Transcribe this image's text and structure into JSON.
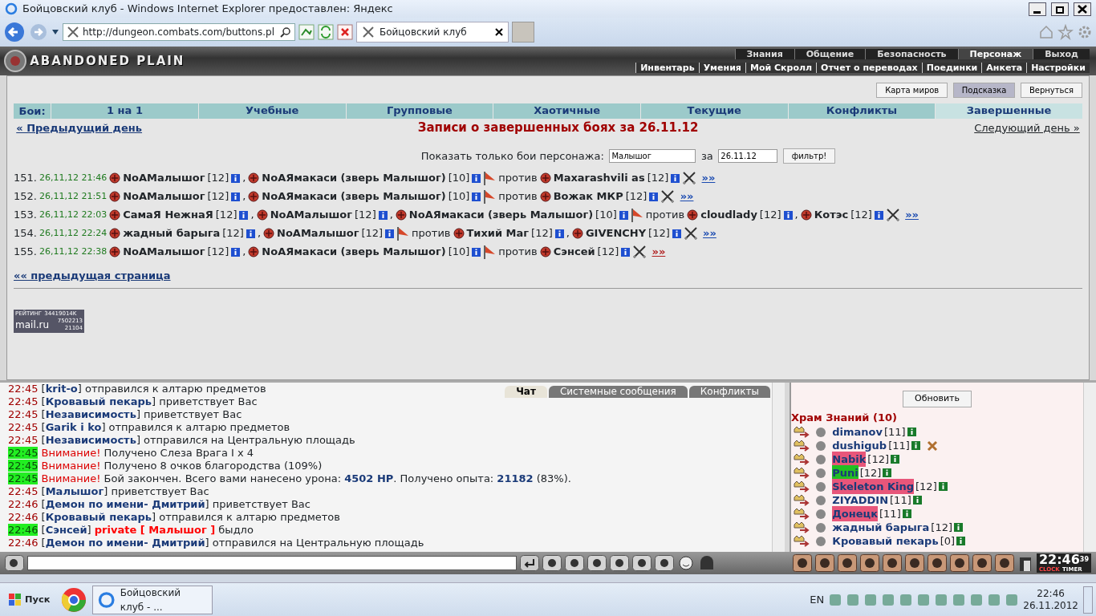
{
  "browser": {
    "title": "Бойцовский клуб - Windows Internet Explorer предоставлен: Яндекс",
    "address": "http://dungeon.combats.com/buttons.pl",
    "tab_title": "Бойцовский клуб"
  },
  "header": {
    "logo": "ABANDONED PLAIN",
    "top_menu": [
      {
        "label": "Знания",
        "selected": false
      },
      {
        "label": "Общение",
        "selected": false
      },
      {
        "label": "Безопасность",
        "selected": false
      },
      {
        "label": "Персонаж",
        "selected": true
      },
      {
        "label": "Выход",
        "selected": false
      }
    ],
    "sub_menu": [
      "Инвентарь",
      "Умения",
      "Мой Скролл",
      "Отчет о переводах",
      "Поединки",
      "Анкета",
      "Настройки"
    ]
  },
  "page_buttons": [
    {
      "label": "Карта миров",
      "selected": false
    },
    {
      "label": "Подсказка",
      "selected": true
    },
    {
      "label": "Вернуться",
      "selected": false
    }
  ],
  "battle_tabs": {
    "label": "Бои:",
    "tabs": [
      {
        "label": "1 на 1",
        "selected": false
      },
      {
        "label": "Учебные",
        "selected": false
      },
      {
        "label": "Групповые",
        "selected": false
      },
      {
        "label": "Хаотичные",
        "selected": false
      },
      {
        "label": "Текущие",
        "selected": false
      },
      {
        "label": "Конфликты",
        "selected": false
      },
      {
        "label": "Завершенные",
        "selected": true
      }
    ]
  },
  "prev_day": "« Предыдущий день",
  "heading": "Записи о завершенных боях за 26.11.12",
  "next_day": "Следующий день »",
  "filter": {
    "label": "Показать только бои персонажа:",
    "name_value": "Малышог",
    "date_label": "за",
    "date_value": "26.11.12",
    "button": "фильтр!"
  },
  "battles": [
    {
      "number": "151.",
      "time": "26,11,12 21:46",
      "team1": [
        {
          "name": "NoAМалышог",
          "level": "[12]",
          "after": ","
        },
        {
          "name": "NoAЯмакаси (зверь Малышог)",
          "level": "[10]"
        }
      ],
      "vs": "против",
      "team2": [
        {
          "name": "Maxarashvili as",
          "level": "[12]"
        }
      ],
      "link": "»»",
      "visited": false
    },
    {
      "number": "152.",
      "time": "26,11,12 21:51",
      "team1": [
        {
          "name": "NoAМалышог",
          "level": "[12]",
          "after": ","
        },
        {
          "name": "NoAЯмакаси (зверь Малышог)",
          "level": "[10]"
        }
      ],
      "vs": "против",
      "team2": [
        {
          "name": "Вожак МКР",
          "level": "[12]"
        }
      ],
      "link": "»»",
      "visited": false
    },
    {
      "number": "153.",
      "time": "26,11,12 22:03",
      "team1": [
        {
          "name": "СамаЯ НежнаЯ",
          "level": "[12]",
          "after": ","
        },
        {
          "name": "NoAМалышог",
          "level": "[12]",
          "after": ","
        },
        {
          "name": "NoAЯмакаси (зверь Малышог)",
          "level": "[10]"
        }
      ],
      "vs": "против",
      "team2": [
        {
          "name": "cloudlady",
          "level": "[12]",
          "after": ","
        },
        {
          "name": "Котэс",
          "level": "[12]"
        }
      ],
      "link": "»»",
      "visited": false
    },
    {
      "number": "154.",
      "time": "26,11,12 22:24",
      "team1": [
        {
          "name": "жадный барыга",
          "level": "[12]",
          "after": ","
        },
        {
          "name": "NoAМалышог",
          "level": "[12]"
        }
      ],
      "vs": "против",
      "team2": [
        {
          "name": "Тихий Маг",
          "level": "[12]",
          "after": ","
        },
        {
          "name": "GIVENCHY",
          "level": "[12]"
        }
      ],
      "link": "»»",
      "visited": false
    },
    {
      "number": "155.",
      "time": "26,11,12 22:38",
      "team1": [
        {
          "name": "NoAМалышог",
          "level": "[12]",
          "after": ","
        },
        {
          "name": "NoAЯмакаси (зверь Малышог)",
          "level": "[10]"
        }
      ],
      "vs": "против",
      "team2": [
        {
          "name": "Сэнсей",
          "level": "[12]"
        }
      ],
      "link": "»»",
      "visited": true
    }
  ],
  "prev_page": "«« предыдущая страница",
  "counter": {
    "title": "РЕЙТИНГ",
    "code": "34419014K",
    "brand": "mail.ru",
    "hits": "7502213",
    "hosts": "21104"
  },
  "chat": {
    "tabs": [
      {
        "label": "Чат",
        "selected": true
      },
      {
        "label": "Системные сообщения",
        "selected": false
      },
      {
        "label": "Конфликты",
        "selected": false
      }
    ],
    "messages": [
      {
        "time": "22:45",
        "highlighted": false,
        "kind": "user",
        "sender": "[**krit-o**]",
        "text": "отправился к алтарю предметов"
      },
      {
        "time": "22:45",
        "highlighted": false,
        "kind": "user",
        "sender": "[**Кровавый пекарь**]",
        "text": "приветствует Вас"
      },
      {
        "time": "22:45",
        "highlighted": false,
        "kind": "user",
        "sender": "[**Независимость**]",
        "text": "приветствует Вас"
      },
      {
        "time": "22:45",
        "highlighted": false,
        "kind": "user",
        "sender": "[**Garik i ko**]",
        "text": "отправился к алтарю предметов"
      },
      {
        "time": "22:45",
        "highlighted": false,
        "kind": "user",
        "sender": "[**Независимость**]",
        "text": "отправился на Центральную площадь"
      },
      {
        "time": "22:45",
        "highlighted": true,
        "kind": "system",
        "alert": "Внимание!",
        "text": "Получено Слеза Врага I x 4"
      },
      {
        "time": "22:45",
        "highlighted": true,
        "kind": "system",
        "alert": "Внимание!",
        "text": "Получено 8 очков благородства (109%)"
      },
      {
        "time": "22:45",
        "highlighted": true,
        "kind": "system",
        "alert": "Внимание!",
        "text": "Бой закончен. Всего вами нанесено урона: **4502 HP**. Получено опыта: **21182** (83%)."
      },
      {
        "time": "22:45",
        "highlighted": false,
        "kind": "user",
        "sender": "[**Малышог**]",
        "text": "приветствует Вас"
      },
      {
        "time": "22:46",
        "highlighted": false,
        "kind": "user",
        "sender": "[**Демон по имени- Дмитрий**]",
        "text": "приветствует Вас"
      },
      {
        "time": "22:46",
        "highlighted": false,
        "kind": "user",
        "sender": "[**Кровавый пекарь**]",
        "text": "отправился к алтарю предметов"
      },
      {
        "time": "22:46",
        "highlighted": true,
        "kind": "private",
        "sender": "[**Сэнсей**]",
        "alert": "private [ Малышог ]",
        "text": "быдло"
      },
      {
        "time": "22:46",
        "highlighted": false,
        "kind": "user",
        "sender": "[**Демон по имени- Дмитрий**]",
        "text": "отправился на Центральную площадь"
      }
    ]
  },
  "room": {
    "refresh": "Обновить",
    "title": "Храм Знаний (10)",
    "users": [
      {
        "name": "dimanov",
        "level": "[11]"
      },
      {
        "name": "dushigub",
        "level": "[11]",
        "marked": true
      },
      {
        "name": "Nabik",
        "level": "[12]",
        "color": "#e8567a"
      },
      {
        "name": "Puni",
        "level": "[12]",
        "color": "#22c022"
      },
      {
        "name": "Skeleton King",
        "level": "[12]",
        "color": "#e8567a"
      },
      {
        "name": "ZIYADDIN",
        "level": "[11]"
      },
      {
        "name": "Донецк",
        "level": "[11]",
        "color": "#e8567a"
      },
      {
        "name": "жадный барыга",
        "level": "[12]"
      },
      {
        "name": "Кровавый пекарь",
        "level": "[0]"
      }
    ]
  },
  "clock": {
    "time": "22:46",
    "seconds": "39",
    "clock_label": "CLOCK",
    "timer_label": "TIMER"
  },
  "taskbar": {
    "start": "Пуск",
    "window": "Бойцовский клуб - ...",
    "lang": "EN",
    "time": "22:46",
    "date": "26.11.2012"
  }
}
